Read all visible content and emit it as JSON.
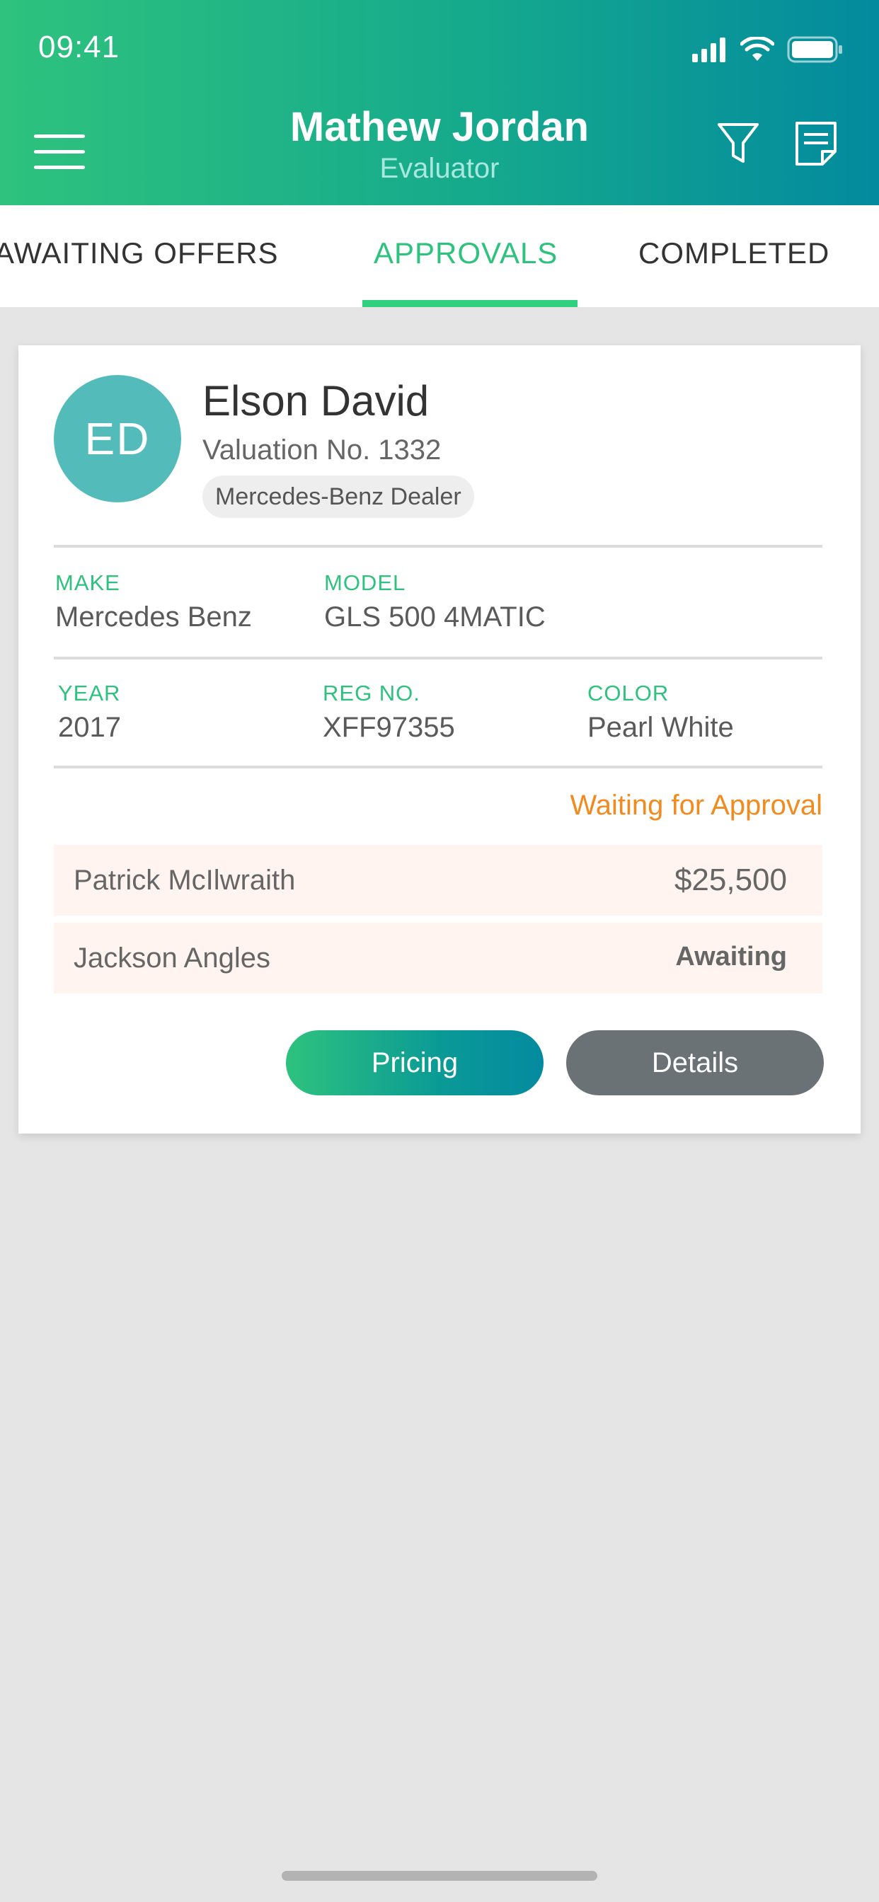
{
  "status_bar": {
    "time": "09:41"
  },
  "header": {
    "title": "Mathew Jordan",
    "subtitle": "Evaluator",
    "menu_icon": "hamburger-menu-icon",
    "filter_icon": "filter-icon",
    "notes_icon": "notes-icon"
  },
  "tabs": [
    {
      "label": "AWAITING OFFERS",
      "active": false
    },
    {
      "label": "APPROVALS",
      "active": true
    },
    {
      "label": "COMPLETED",
      "active": false
    }
  ],
  "card": {
    "initials": "ED",
    "name": "Elson David",
    "valuation": "Valuation No. 1332",
    "dealer": "Mercedes-Benz Dealer",
    "fields": {
      "make": {
        "label": "MAKE",
        "value": "Mercedes Benz"
      },
      "model": {
        "label": "MODEL",
        "value": "GLS 500 4MATIC"
      },
      "year": {
        "label": "YEAR",
        "value": "2017"
      },
      "reg": {
        "label": "REG NO.",
        "value": "XFF97355"
      },
      "color": {
        "label": "COLOR",
        "value": "Pearl White"
      }
    },
    "status": "Waiting for Approval",
    "offers": [
      {
        "name": "Patrick McIlwraith",
        "value": "$25,500"
      },
      {
        "name": "Jackson Angles",
        "value": "Awaiting"
      }
    ],
    "buttons": {
      "pricing": "Pricing",
      "details": "Details"
    }
  },
  "colors": {
    "accent": "#2ec27e",
    "header_end": "#038a9e",
    "status_orange": "#f28b1f",
    "avatar_bg": "#53bcbb",
    "details_button": "#6b7275"
  }
}
